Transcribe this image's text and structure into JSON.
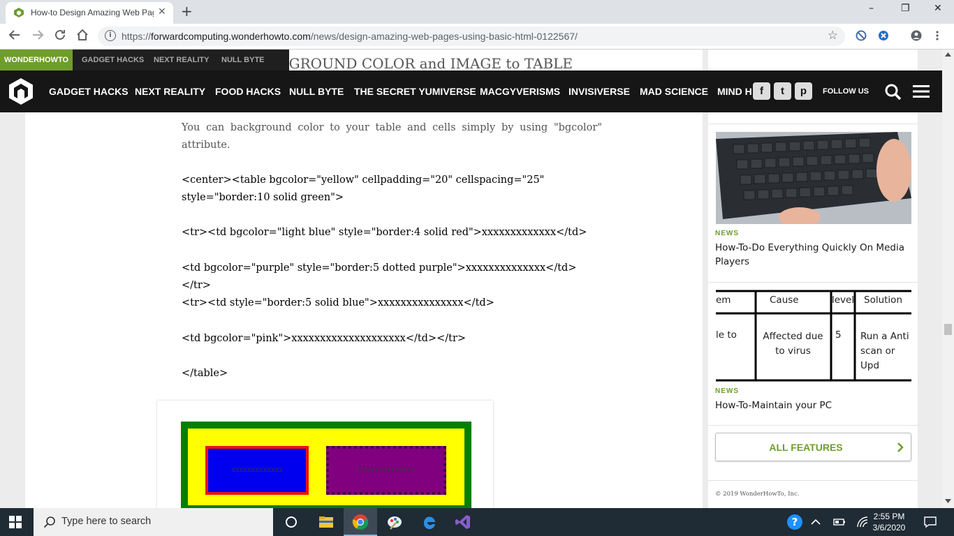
{
  "browser": {
    "tab_title": "How-to Design Amazing Web Pages Using Basic HTML",
    "new_tab_glyph": "+",
    "close_glyph": "✕",
    "url_prefix": "https://",
    "url_host": "forwardcomputing.wonderhowto.com",
    "url_path": "/news/design-amazing-web-pages-using-basic-html-0122567/",
    "window": {
      "minimize": "–",
      "restore": "❐",
      "close": "✕"
    }
  },
  "site": {
    "brand": "WONDERHOWTO",
    "top_links": [
      "GADGET HACKS",
      "NEXT REALITY",
      "NULL BYTE"
    ],
    "nav_links": [
      "GADGET HACKS",
      "NEXT REALITY",
      "FOOD HACKS",
      "NULL BYTE",
      "THE SECRET YUMIVERSE",
      "MACGYVERISMS",
      "INVISIVERSE",
      "MAD SCIENCE",
      "MIND H"
    ],
    "follow_us": "FOLLOW US",
    "social": {
      "facebook": "f",
      "twitter": "t",
      "pinterest": "p"
    },
    "accent_color": "#6e9d2c"
  },
  "article": {
    "ghost_heading": "ADDING BACKGROUND COLOR and IMAGE to TABLE",
    "intro": "You can background color to your table and cells simply by using \"bgcolor\" attribute.",
    "code_lines": [
      "<center><table bgcolor=\"yellow\" cellpadding=\"20\" cellspacing=\"25\" style=\"border:10 solid green\">",
      "<tr><td bgcolor=\"light blue\" style=\"border:4 solid red\">xxxxxxxxxxxxx</td>",
      "<td bgcolor=\"purple\" style=\"border:5 dotted purple\">xxxxxxxxxxxxxx</td></tr>",
      "<tr><td style=\"border:5 solid blue\">xxxxxxxxxxxxxxx</td>",
      "<td bgcolor=\"pink\">xxxxxxxxxxxxxxxxxxxx</td></tr>",
      "</table>"
    ],
    "demo_cells": [
      "xxxxxxxxxxxxx",
      "xxxxxxxxxxxxxx"
    ]
  },
  "sidebar": {
    "cards": [
      {
        "tag": "NEWS",
        "title": "How-To-Do Everything Quickly On Media Players"
      },
      {
        "tag": "NEWS",
        "title": "How-To-Maintain your PC"
      }
    ],
    "table_image": {
      "headers": [
        "em",
        "Cause",
        "level",
        "Solution"
      ],
      "row": [
        "le to",
        "Affected due to virus",
        "5",
        "Run a Anti scan or Upd"
      ]
    },
    "all_features": "ALL FEATURES",
    "copyright": "© 2019 WonderHowTo, Inc."
  },
  "taskbar": {
    "search_placeholder": "Type here to search",
    "time": "2:55 PM",
    "date": "3/6/2020"
  }
}
